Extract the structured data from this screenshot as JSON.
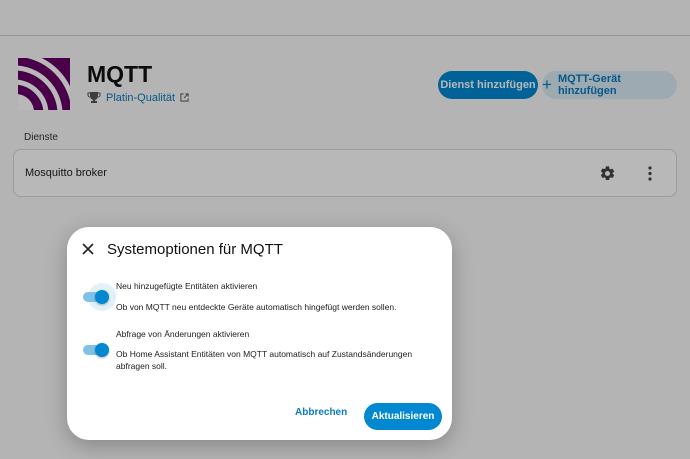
{
  "integration": {
    "title": "MQTT",
    "quality_label": "Platin-Qualität",
    "trophy_icon": "trophy-icon",
    "external_link_icon": "open-in-new-icon",
    "brand_color": "#660066"
  },
  "actions": {
    "add_service": "Dienst hinzufügen",
    "add_device": "MQTT-Gerät hinzufügen",
    "add_device_icon": "+"
  },
  "services": {
    "section_label": "Dienste",
    "items": [
      {
        "name": "Mosquitto broker",
        "settings_icon": "gear-icon",
        "menu_icon": "more-vert-icon"
      }
    ]
  },
  "dialog": {
    "title": "Systemoptionen für MQTT",
    "close_icon": "close-icon",
    "options": [
      {
        "label": "Neu hinzugefügte Entitäten aktivieren",
        "description": "Ob von MQTT neu entdeckte Geräte automatisch hingefügt werden sollen.",
        "enabled": true
      },
      {
        "label": "Abfrage von Änderungen aktivieren",
        "description": "Ob Home Assistant Entitäten von MQTT automatisch auf Zustandsänderungen abfragen soll.",
        "enabled": true
      }
    ],
    "cancel_label": "Abbrechen",
    "update_label": "Aktualisieren"
  },
  "colors": {
    "accent": "#0288d1",
    "accent_text": "#0b7bbd"
  }
}
